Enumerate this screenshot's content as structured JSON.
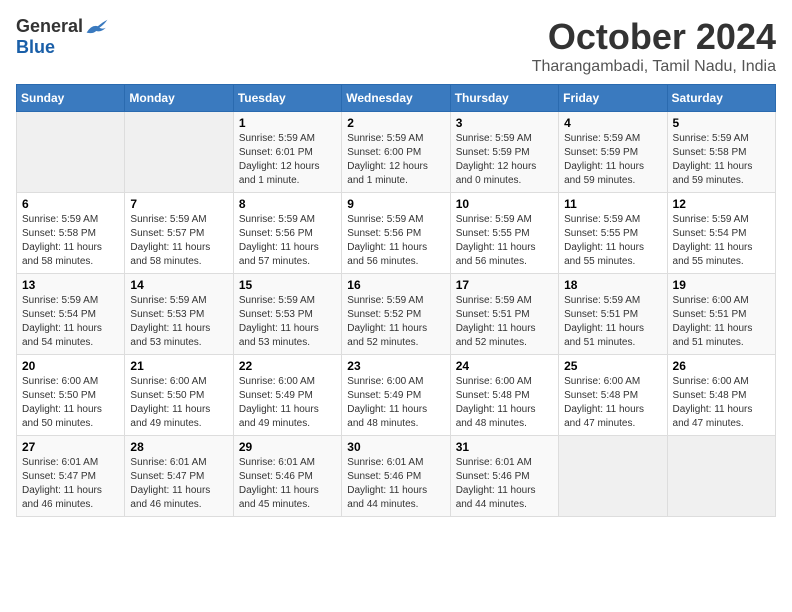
{
  "logo": {
    "general": "General",
    "blue": "Blue"
  },
  "title": {
    "month": "October 2024",
    "location": "Tharangambadi, Tamil Nadu, India"
  },
  "headers": [
    "Sunday",
    "Monday",
    "Tuesday",
    "Wednesday",
    "Thursday",
    "Friday",
    "Saturday"
  ],
  "weeks": [
    [
      {
        "day": "",
        "info": ""
      },
      {
        "day": "",
        "info": ""
      },
      {
        "day": "1",
        "info": "Sunrise: 5:59 AM\nSunset: 6:01 PM\nDaylight: 12 hours\nand 1 minute."
      },
      {
        "day": "2",
        "info": "Sunrise: 5:59 AM\nSunset: 6:00 PM\nDaylight: 12 hours\nand 1 minute."
      },
      {
        "day": "3",
        "info": "Sunrise: 5:59 AM\nSunset: 5:59 PM\nDaylight: 12 hours\nand 0 minutes."
      },
      {
        "day": "4",
        "info": "Sunrise: 5:59 AM\nSunset: 5:59 PM\nDaylight: 11 hours\nand 59 minutes."
      },
      {
        "day": "5",
        "info": "Sunrise: 5:59 AM\nSunset: 5:58 PM\nDaylight: 11 hours\nand 59 minutes."
      }
    ],
    [
      {
        "day": "6",
        "info": "Sunrise: 5:59 AM\nSunset: 5:58 PM\nDaylight: 11 hours\nand 58 minutes."
      },
      {
        "day": "7",
        "info": "Sunrise: 5:59 AM\nSunset: 5:57 PM\nDaylight: 11 hours\nand 58 minutes."
      },
      {
        "day": "8",
        "info": "Sunrise: 5:59 AM\nSunset: 5:56 PM\nDaylight: 11 hours\nand 57 minutes."
      },
      {
        "day": "9",
        "info": "Sunrise: 5:59 AM\nSunset: 5:56 PM\nDaylight: 11 hours\nand 56 minutes."
      },
      {
        "day": "10",
        "info": "Sunrise: 5:59 AM\nSunset: 5:55 PM\nDaylight: 11 hours\nand 56 minutes."
      },
      {
        "day": "11",
        "info": "Sunrise: 5:59 AM\nSunset: 5:55 PM\nDaylight: 11 hours\nand 55 minutes."
      },
      {
        "day": "12",
        "info": "Sunrise: 5:59 AM\nSunset: 5:54 PM\nDaylight: 11 hours\nand 55 minutes."
      }
    ],
    [
      {
        "day": "13",
        "info": "Sunrise: 5:59 AM\nSunset: 5:54 PM\nDaylight: 11 hours\nand 54 minutes."
      },
      {
        "day": "14",
        "info": "Sunrise: 5:59 AM\nSunset: 5:53 PM\nDaylight: 11 hours\nand 53 minutes."
      },
      {
        "day": "15",
        "info": "Sunrise: 5:59 AM\nSunset: 5:53 PM\nDaylight: 11 hours\nand 53 minutes."
      },
      {
        "day": "16",
        "info": "Sunrise: 5:59 AM\nSunset: 5:52 PM\nDaylight: 11 hours\nand 52 minutes."
      },
      {
        "day": "17",
        "info": "Sunrise: 5:59 AM\nSunset: 5:51 PM\nDaylight: 11 hours\nand 52 minutes."
      },
      {
        "day": "18",
        "info": "Sunrise: 5:59 AM\nSunset: 5:51 PM\nDaylight: 11 hours\nand 51 minutes."
      },
      {
        "day": "19",
        "info": "Sunrise: 6:00 AM\nSunset: 5:51 PM\nDaylight: 11 hours\nand 51 minutes."
      }
    ],
    [
      {
        "day": "20",
        "info": "Sunrise: 6:00 AM\nSunset: 5:50 PM\nDaylight: 11 hours\nand 50 minutes."
      },
      {
        "day": "21",
        "info": "Sunrise: 6:00 AM\nSunset: 5:50 PM\nDaylight: 11 hours\nand 49 minutes."
      },
      {
        "day": "22",
        "info": "Sunrise: 6:00 AM\nSunset: 5:49 PM\nDaylight: 11 hours\nand 49 minutes."
      },
      {
        "day": "23",
        "info": "Sunrise: 6:00 AM\nSunset: 5:49 PM\nDaylight: 11 hours\nand 48 minutes."
      },
      {
        "day": "24",
        "info": "Sunrise: 6:00 AM\nSunset: 5:48 PM\nDaylight: 11 hours\nand 48 minutes."
      },
      {
        "day": "25",
        "info": "Sunrise: 6:00 AM\nSunset: 5:48 PM\nDaylight: 11 hours\nand 47 minutes."
      },
      {
        "day": "26",
        "info": "Sunrise: 6:00 AM\nSunset: 5:48 PM\nDaylight: 11 hours\nand 47 minutes."
      }
    ],
    [
      {
        "day": "27",
        "info": "Sunrise: 6:01 AM\nSunset: 5:47 PM\nDaylight: 11 hours\nand 46 minutes."
      },
      {
        "day": "28",
        "info": "Sunrise: 6:01 AM\nSunset: 5:47 PM\nDaylight: 11 hours\nand 46 minutes."
      },
      {
        "day": "29",
        "info": "Sunrise: 6:01 AM\nSunset: 5:46 PM\nDaylight: 11 hours\nand 45 minutes."
      },
      {
        "day": "30",
        "info": "Sunrise: 6:01 AM\nSunset: 5:46 PM\nDaylight: 11 hours\nand 44 minutes."
      },
      {
        "day": "31",
        "info": "Sunrise: 6:01 AM\nSunset: 5:46 PM\nDaylight: 11 hours\nand 44 minutes."
      },
      {
        "day": "",
        "info": ""
      },
      {
        "day": "",
        "info": ""
      }
    ]
  ]
}
